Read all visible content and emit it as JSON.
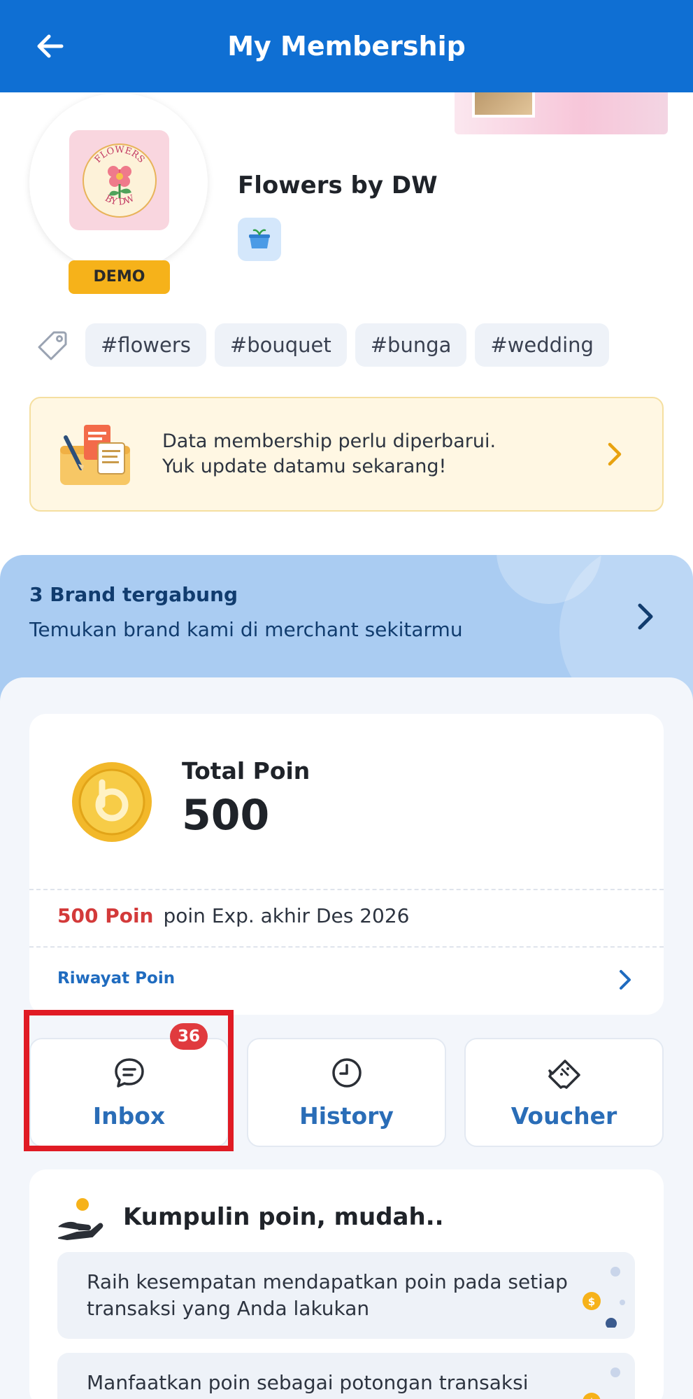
{
  "header": {
    "title": "My Membership",
    "back_icon": "arrow-left-icon",
    "background": "#0f6fd3"
  },
  "merchant": {
    "name": "Flowers by DW",
    "logo_text_top": "FLOWERS",
    "logo_text_bottom": "BY DW",
    "badge": "DEMO",
    "category_icon": "basket-icon"
  },
  "tags": [
    "#flowers",
    "#bouquet",
    "#bunga",
    "#wedding"
  ],
  "update_banner": {
    "line1": "Data membership perlu diperbarui.",
    "line2": "Yuk update datamu sekarang!"
  },
  "brands": {
    "title": "3 Brand tergabung",
    "subtitle": "Temukan brand kami di merchant sekitarmu"
  },
  "points": {
    "label": "Total Poin",
    "value": "500",
    "expiring_points": "500 Poin",
    "expiry_text": "poin Exp. akhir Des 2026",
    "history_link": "Riwayat Poin"
  },
  "actions": {
    "inbox": {
      "label": "Inbox",
      "badge": "36",
      "icon": "chat-bubble-icon"
    },
    "history": {
      "label": "History",
      "icon": "clock-icon"
    },
    "voucher": {
      "label": "Voucher",
      "icon": "voucher-ticket-icon"
    }
  },
  "earn": {
    "title": "Kumpulin poin, mudah..",
    "items": [
      "Raih kesempatan mendapatkan poin pada setiap transaksi yang Anda lakukan",
      "Manfaatkan poin sebagai potongan transaksi"
    ]
  },
  "colors": {
    "accent_blue": "#0f6fd3",
    "badge_red": "#e03a3e",
    "demo_yellow": "#f6b21a",
    "highlight_red": "#e01b24"
  }
}
